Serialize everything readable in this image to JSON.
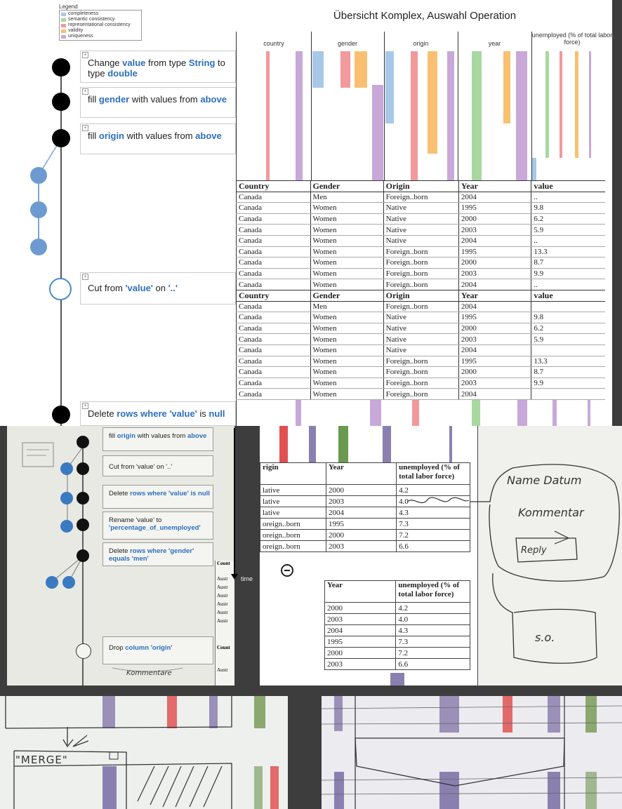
{
  "legend": {
    "title": "Legend",
    "items": [
      {
        "label": "completeness",
        "color": "#a8c8e8"
      },
      {
        "label": "semantic consistency",
        "color": "#a8d8a0"
      },
      {
        "label": "representational consistency",
        "color": "#f2999c"
      },
      {
        "label": "validity",
        "color": "#f8c070"
      },
      {
        "label": "uniqueness",
        "color": "#c8a8d8"
      }
    ]
  },
  "title": "Übersicht Komplex, Auswahl Operation",
  "operations": [
    {
      "pre": "Change ",
      "k1": "value",
      "mid": " from type ",
      "k2": "String",
      "post": " to type ",
      "k3": "double"
    },
    {
      "pre": "fill ",
      "k1": "gender",
      "mid": " with values from ",
      "k2": "above",
      "post": "",
      "k3": ""
    },
    {
      "pre": "fill ",
      "k1": "origin",
      "mid": " with values from ",
      "k2": "above",
      "post": "",
      "k3": ""
    },
    {
      "pre": "Cut from ",
      "k1": "'value'",
      "mid": " on ",
      "k2": "'..'",
      "post": "",
      "k3": ""
    },
    {
      "pre": "Delete ",
      "k1": "rows where 'value'",
      "mid": " is ",
      "k2": "null",
      "post": "",
      "k3": ""
    }
  ],
  "columns": [
    "country",
    "gender",
    "origin",
    "year",
    "unemployed (% of total labor force)"
  ],
  "table_headers": [
    "Country",
    "Gender",
    "Origin",
    "Year",
    "value"
  ],
  "table1_rows": [
    [
      "Canada",
      "Men",
      "Foreign..born",
      "2004",
      ".."
    ],
    [
      "Canada",
      "Women",
      "Native",
      "1995",
      "9.8"
    ],
    [
      "Canada",
      "Women",
      "Native",
      "2000",
      "6.2"
    ],
    [
      "Canada",
      "Women",
      "Native",
      "2003",
      "5.9"
    ],
    [
      "Canada",
      "Women",
      "Native",
      "2004",
      ".."
    ],
    [
      "Canada",
      "Women",
      "Foreign..born",
      "1995",
      "13.3"
    ],
    [
      "Canada",
      "Women",
      "Foreign..born",
      "2000",
      "8.7"
    ],
    [
      "Canada",
      "Women",
      "Foreign..born",
      "2003",
      "9.9"
    ],
    [
      "Canada",
      "Women",
      "Foreign..born",
      "2004",
      ".."
    ]
  ],
  "table2_rows": [
    [
      "Canada",
      "Men",
      "Foreign..born",
      "2004",
      ""
    ],
    [
      "Canada",
      "Women",
      "Native",
      "1995",
      "9.8"
    ],
    [
      "Canada",
      "Women",
      "Native",
      "2000",
      "6.2"
    ],
    [
      "Canada",
      "Women",
      "Native",
      "2003",
      "5.9"
    ],
    [
      "Canada",
      "Women",
      "Native",
      "2004",
      ""
    ],
    [
      "Canada",
      "Women",
      "Foreign..born",
      "1995",
      "13.3"
    ],
    [
      "Canada",
      "Women",
      "Foreign..born",
      "2000",
      "8.7"
    ],
    [
      "Canada",
      "Women",
      "Foreign..born",
      "2003",
      "9.9"
    ],
    [
      "Canada",
      "Women",
      "Foreign..born",
      "2004",
      ""
    ]
  ],
  "photo1": {
    "ops": [
      {
        "pre": "fill ",
        "k1": "origin",
        "mid": " with values from ",
        "k2": "above"
      },
      {
        "pre": "Cut from 'value' on '..'",
        "k1": "",
        "mid": "",
        "k2": ""
      },
      {
        "pre": "Delete ",
        "k1": "rows where 'value'",
        "mid": " ",
        "k2": "is null"
      },
      {
        "pre": "Rename 'value' to ",
        "k1": "'percentage_of_unemployed'",
        "mid": "",
        "k2": ""
      },
      {
        "pre": "Delete ",
        "k1": "rows where 'gender'",
        "mid": " ",
        "k2": "equals 'men'"
      },
      {
        "pre": "Drop ",
        "k1": "column 'origin'",
        "mid": "",
        "k2": ""
      }
    ],
    "side_labels": [
      "Count",
      "Austr",
      "Austr",
      "Austr",
      "Austr",
      "Austr",
      "Austr",
      "Count",
      "Austr"
    ],
    "time_label": "time",
    "sketch_text": "Kommentare"
  },
  "photo2": {
    "headers": [
      "rigin",
      "Year",
      "unemployed (% of total labor force)"
    ],
    "rows": [
      [
        "lative",
        "2000",
        "4.2"
      ],
      [
        "lative",
        "2003",
        "4.0"
      ],
      [
        "lative",
        "2004",
        "4.3"
      ],
      [
        "oreign..born",
        "1995",
        "7.3"
      ],
      [
        "oreign..born",
        "2000",
        "7.2"
      ],
      [
        "oreign..born",
        "2003",
        "6.6"
      ]
    ],
    "headers2": [
      "Year",
      "unemployed (% of total labor force)"
    ],
    "rows2": [
      [
        "2000",
        "4.2"
      ],
      [
        "2003",
        "4.0"
      ],
      [
        "2004",
        "4.3"
      ],
      [
        "1995",
        "7.3"
      ],
      [
        "2000",
        "7.2"
      ],
      [
        "2003",
        "6.6"
      ]
    ],
    "sketch": {
      "name": "Name Datum",
      "comment": "Kommentar",
      "reply": "Reply",
      "so": "s.o."
    }
  },
  "photo3": {
    "merge": "\"MERGE\""
  }
}
